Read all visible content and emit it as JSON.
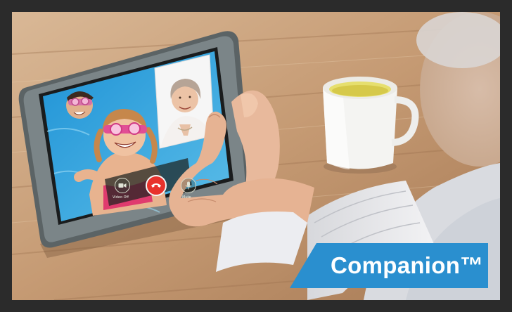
{
  "brand": {
    "name": "Companion™",
    "color": "#2a8fcf"
  },
  "call_controls": {
    "video_label": "Video Off",
    "mute_label": "Mute"
  },
  "colors": {
    "frame": "#2b2b2b",
    "end_call": "#e8322c",
    "table_wood": "#c89f7a"
  }
}
